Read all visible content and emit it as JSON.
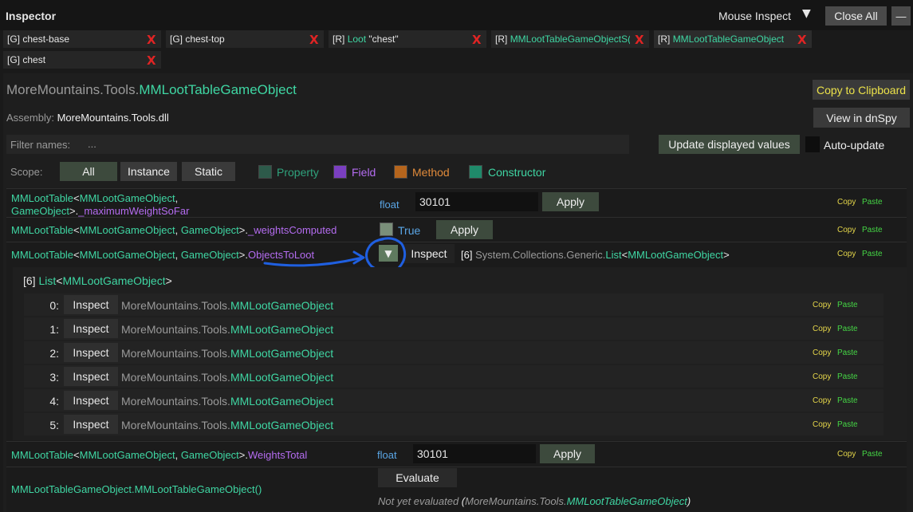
{
  "window": {
    "title": "Inspector",
    "mouse_inspect_label": "Mouse Inspect",
    "mouse_inspect_arrow": "▼",
    "close_all_label": "Close All",
    "minimize_label": "—"
  },
  "tabs": [
    {
      "prefix": "[G]",
      "label": "chest-base"
    },
    {
      "prefix": "[G]",
      "label": "chest-top"
    },
    {
      "prefix": "[R]",
      "label_type": "Loot",
      "label_rest": "\"chest\""
    },
    {
      "prefix": "[R]",
      "label": "MMLootTableGameObjectS("
    },
    {
      "prefix": "[R]",
      "label": "MMLootTableGameObject"
    },
    {
      "prefix": "[G]",
      "label": "chest"
    }
  ],
  "tab_close": "X",
  "header": {
    "namespace": "MoreMountains.Tools.",
    "type_name": "MMLootTableGameObject",
    "copy_clipboard_label": "Copy to Clipboard",
    "assembly_label": "Assembly:",
    "assembly_value": "MoreMountains.Tools.dll",
    "dnspy_label": "View in dnSpy"
  },
  "filter": {
    "label": "Filter names:",
    "placeholder": "...",
    "update_label": "Update displayed values",
    "auto_update_label": "Auto-update"
  },
  "scope": {
    "label": "Scope:",
    "buttons": [
      "All",
      "Instance",
      "Static"
    ],
    "legend": [
      {
        "label": "Property",
        "color": "#2d5a4a"
      },
      {
        "label": "Field",
        "color": "#7a3fc0"
      },
      {
        "label": "Method",
        "color": "#b5651d"
      },
      {
        "label": "Constructor",
        "color": "#1f8a6a"
      }
    ]
  },
  "members": {
    "m1": {
      "generic_a": "MMLootTable",
      "generic_b": "MMLootGameObject",
      "generic_c": "GameObject",
      "name": "_maximumWeightSoFar",
      "type": "float",
      "value": "30101",
      "apply": "Apply"
    },
    "m2": {
      "name": "_weightsComputed",
      "bool_value": "True",
      "apply": "Apply"
    },
    "m3": {
      "name": "ObjectsToLoot",
      "expand": "▼",
      "inspect": "Inspect",
      "count": "[6]",
      "ns_prefix": "System.Collections.Generic.",
      "list_word": "List",
      "generic_arg": "MMLootGameObject"
    },
    "list_header": {
      "count": "[6]",
      "list_word": "List",
      "generic_arg": "MMLootGameObject"
    },
    "list_items": [
      {
        "index": "0:",
        "inspect": "Inspect",
        "ns": "MoreMountains.Tools.",
        "type": "MMLootGameObject"
      },
      {
        "index": "1:",
        "inspect": "Inspect",
        "ns": "MoreMountains.Tools.",
        "type": "MMLootGameObject"
      },
      {
        "index": "2:",
        "inspect": "Inspect",
        "ns": "MoreMountains.Tools.",
        "type": "MMLootGameObject"
      },
      {
        "index": "3:",
        "inspect": "Inspect",
        "ns": "MoreMountains.Tools.",
        "type": "MMLootGameObject"
      },
      {
        "index": "4:",
        "inspect": "Inspect",
        "ns": "MoreMountains.Tools.",
        "type": "MMLootGameObject"
      },
      {
        "index": "5:",
        "inspect": "Inspect",
        "ns": "MoreMountains.Tools.",
        "type": "MMLootGameObject"
      }
    ],
    "m4": {
      "name": "WeightsTotal",
      "type": "float",
      "value": "30101",
      "apply": "Apply"
    },
    "m5": {
      "signature": "MMLootTableGameObject.MMLootTableGameObject()",
      "evaluate": "Evaluate",
      "not_evaluated": "Not yet evaluated",
      "result_ns": "MoreMountains.Tools.",
      "result_type": "MMLootTableGameObject"
    }
  },
  "copy_label": "Copy",
  "paste_label": "Paste",
  "colors": {
    "accent_green": "#3fd6a3",
    "field_purple": "#b46cf0",
    "type_blue": "#5aa6e6",
    "close_red": "#e02424",
    "copy_yellow": "#e5d64a",
    "paste_green": "#45d645",
    "annotation_blue": "#1f5fe0"
  }
}
